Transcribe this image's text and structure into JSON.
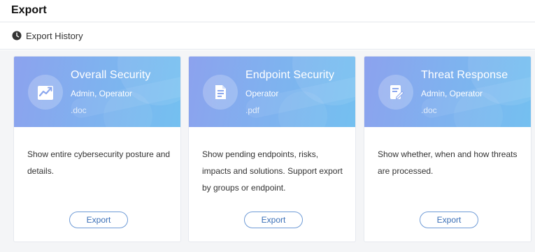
{
  "header": {
    "title": "Export"
  },
  "toolbar": {
    "history_label": "Export History",
    "history_icon": "clock-icon"
  },
  "colors": {
    "header_gradient_start": "#8ca2ee",
    "header_gradient_end": "#74c0f0",
    "button_border": "#6f9bd6",
    "button_text": "#3a6fb7"
  },
  "cards": [
    {
      "title": "Overall Security",
      "roles": "Admin, Operator",
      "format": ".doc",
      "icon": "chart-trend-icon",
      "description": "Show entire cybersecurity posture and details.",
      "button": "Export"
    },
    {
      "title": "Endpoint Security",
      "roles": "Operator",
      "format": ".pdf",
      "icon": "document-icon",
      "description": "Show pending endpoints, risks, impacts and solutions. Support export by groups or endpoint.",
      "button": "Export"
    },
    {
      "title": "Threat Response",
      "roles": "Admin, Operator",
      "format": ".doc",
      "icon": "edit-document-icon",
      "description": "Show whether, when and how threats are processed.",
      "button": "Export"
    }
  ]
}
